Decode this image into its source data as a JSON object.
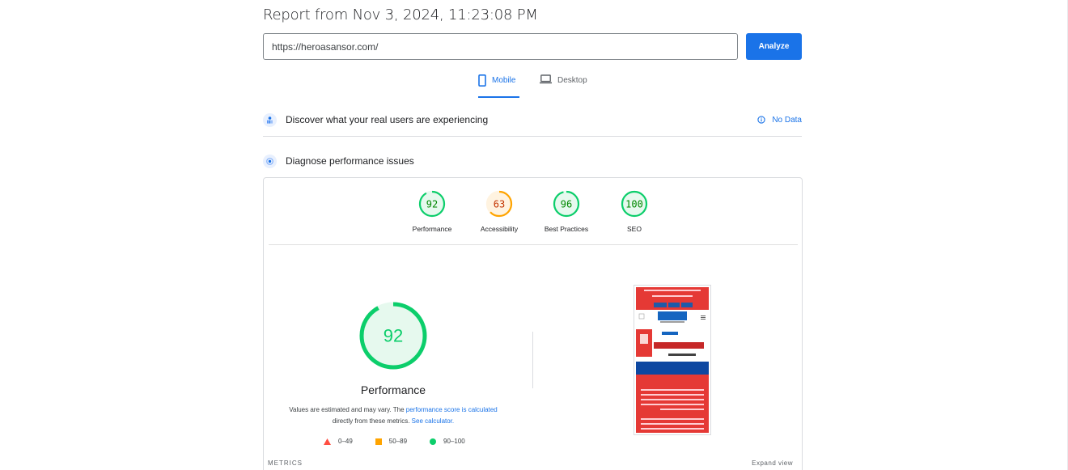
{
  "report": {
    "title": "Report from Nov 3, 2024, 11:23:08 PM"
  },
  "url_input": {
    "value": "https://heroasansor.com/"
  },
  "analyze_button": {
    "label": "Analyze"
  },
  "tabs": [
    {
      "label": "Mobile",
      "active": true
    },
    {
      "label": "Desktop",
      "active": false
    }
  ],
  "field_data": {
    "title": "Discover what your real users are experiencing",
    "status": "No Data"
  },
  "lab_data": {
    "title": "Diagnose performance issues"
  },
  "categories": [
    {
      "label": "Performance",
      "score": "92",
      "score_value": 92,
      "color": "#0cce6b"
    },
    {
      "label": "Accessibility",
      "score": "63",
      "score_value": 63,
      "color": "#ffa400"
    },
    {
      "label": "Best Practices",
      "score": "96",
      "score_value": 96,
      "color": "#0cce6b"
    },
    {
      "label": "SEO",
      "score": "100",
      "score_value": 100,
      "color": "#0cce6b"
    }
  ],
  "performance": {
    "score": "92",
    "score_value": 92,
    "title": "Performance",
    "desc_prefix": "Values are estimated and may vary. The ",
    "desc_link1": "performance score is calculated",
    "desc_mid": " directly from these metrics. ",
    "desc_link2": "See calculator."
  },
  "legend": [
    {
      "range": "0–49",
      "color": "#ff4e42",
      "shape": "triangle"
    },
    {
      "range": "50–89",
      "color": "#ffa400",
      "shape": "square"
    },
    {
      "range": "90–100",
      "color": "#0cce6b",
      "shape": "circle"
    }
  ],
  "metrics": {
    "label": "METRICS",
    "expand": "Expand view"
  },
  "colors": {
    "accent": "#1a73e8",
    "pass": "#0cce6b",
    "average": "#ffa400",
    "fail": "#ff4e42"
  }
}
